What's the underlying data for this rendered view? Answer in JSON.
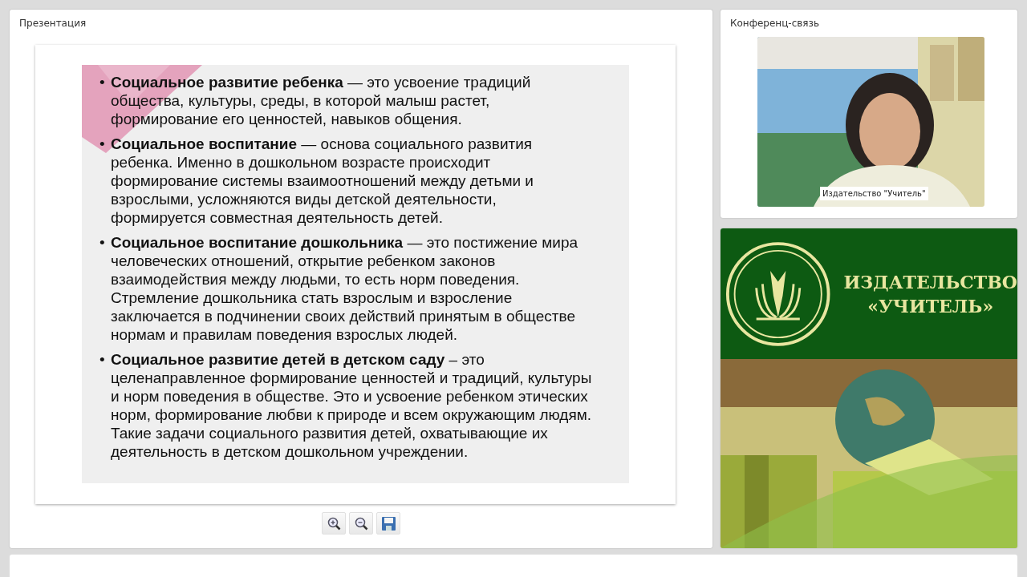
{
  "presentation": {
    "title": "Презентация",
    "slide": {
      "bullets": [
        {
          "marker": "•",
          "text": "**Социальное развитие ребенка** — это усвоение традиций общества, культуры, среды, в которой малыш растет, формирование его ценностей, навыков общения."
        },
        {
          "marker": "•",
          "text": "**Социальное воспитание**  — основа социального развития ребенка. Именно в дошкольном возрасте происходит формирование системы взаимоотношений между детьми и взрослыми, усложняются виды детской деятельности, формируется совместная деятельность детей."
        },
        {
          "marker": "•",
          "text": "**Социальное воспитание дошкольника** — это постижение мира человеческих отношений, открытие ребенком законов взаимодействия между людьми, то есть норм поведения. Стремление дошкольника стать взрослым и взросление заключается в подчинении своих действий принятым в обществе нормам и правилам поведения взрослых людей."
        },
        {
          "marker": "•",
          "text": "**Социальное развитие детей в детском саду** – это целенаправленное формирование ценностей и традиций, культуры и норм поведения в обществе. Это и усвоение ребенком этических норм, формирование любви к природе и всем окружающим людям. Такие задачи социального развития детей, охватывающие их деятельность в детском дошкольном учреждении."
        }
      ]
    },
    "toolbar": [
      {
        "kind": "zoom-in"
      },
      {
        "kind": "zoom-out"
      },
      {
        "kind": "save"
      }
    ]
  },
  "conference": {
    "title": "Конференц-связь",
    "video": {
      "kind": "picture",
      "caption": "Издательство \"Учитель\""
    }
  },
  "banner": {
    "lines": [
      "ИЗДАТЕЛЬСТВО",
      "«УЧИТЕЛЬ»"
    ],
    "photo": {
      "kind": "picture"
    }
  }
}
